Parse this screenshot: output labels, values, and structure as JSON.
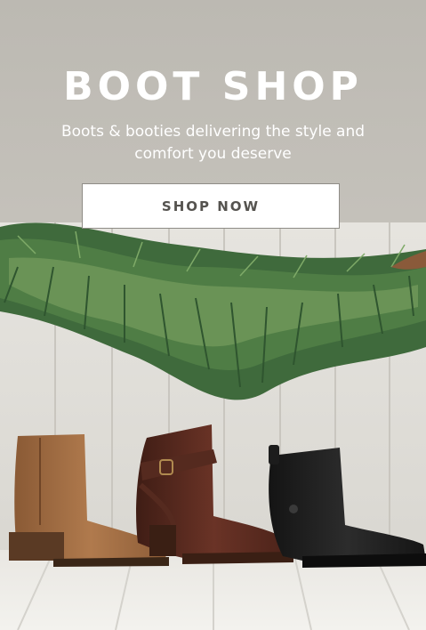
{
  "banner": {
    "title": "BOOT SHOP",
    "subtitle": "Boots & booties delivering the style and comfort you deserve",
    "cta_label": "SHOP NOW"
  },
  "colors": {
    "background": "#bcb9b2",
    "text": "#ffffff",
    "button_bg": "#ffffff",
    "button_text": "#55534f"
  },
  "image": {
    "boots": [
      "tan-ankle-boot",
      "brown-buckle-boot",
      "black-ankle-boot"
    ]
  }
}
